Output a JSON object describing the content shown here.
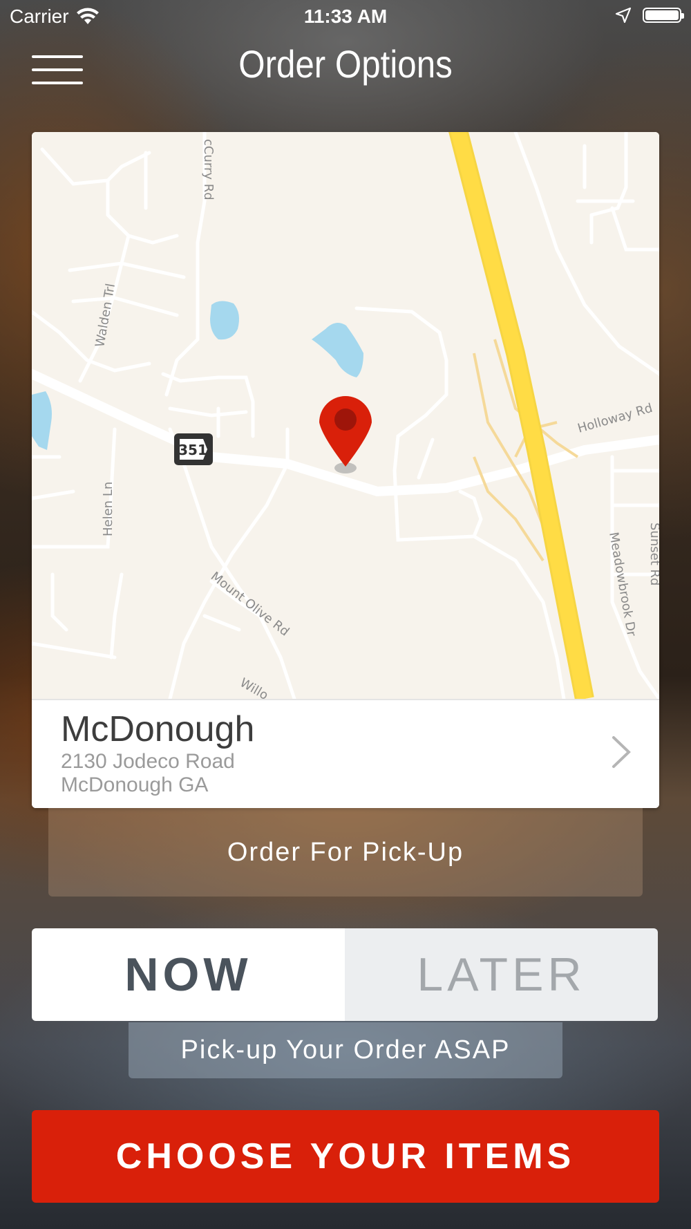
{
  "status_bar": {
    "carrier": "Carrier",
    "time": "11:33 AM"
  },
  "header": {
    "title": "Order Options"
  },
  "map": {
    "streets": {
      "mccurry": "cCurry Rd",
      "walden": "Walden Trl",
      "helen": "Helen Ln",
      "mount_olive": "Mount Olive Rd",
      "willo": "Willo",
      "holloway": "Holloway Rd",
      "meadowbrook": "Meadowbrook Dr",
      "sunset": "Sunset Rd"
    },
    "route_shield": "351"
  },
  "store": {
    "name": "McDonough",
    "address_line1": "2130 Jodeco Road",
    "address_line2": "McDonough GA"
  },
  "order_type": {
    "label": "Order For Pick-Up"
  },
  "timing": {
    "now_label": "NOW",
    "later_label": "LATER",
    "selected": "NOW"
  },
  "timing_note": "Pick-up Your Order ASAP",
  "cta": {
    "label": "CHOOSE YOUR ITEMS"
  }
}
